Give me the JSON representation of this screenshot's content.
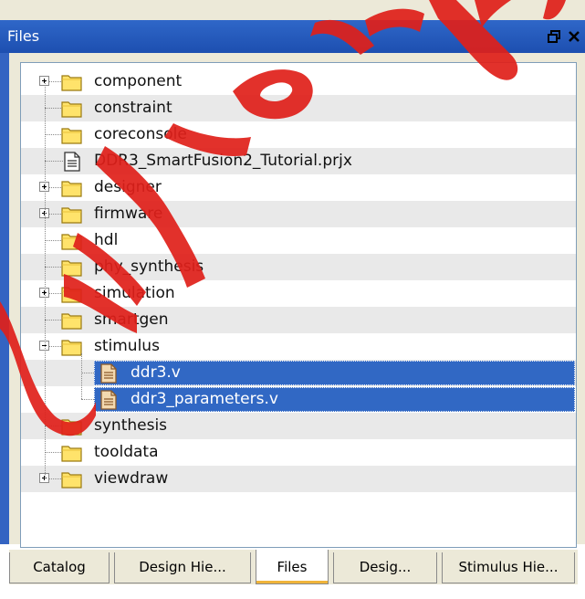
{
  "panel": {
    "title": "Files",
    "restore_icon": "restore-icon",
    "close_icon": "close-icon"
  },
  "tree": {
    "items": [
      {
        "label": "component",
        "type": "folder",
        "expander": "plus"
      },
      {
        "label": "constraint",
        "type": "folder",
        "expander": "none"
      },
      {
        "label": "coreconsole",
        "type": "folder",
        "expander": "none"
      },
      {
        "label": "DDR3_SmartFusion2_Tutorial.prjx",
        "type": "file",
        "expander": "none"
      },
      {
        "label": "designer",
        "type": "folder",
        "expander": "plus"
      },
      {
        "label": "firmware",
        "type": "folder",
        "expander": "plus"
      },
      {
        "label": "hdl",
        "type": "folder",
        "expander": "none"
      },
      {
        "label": "phy_synthesis",
        "type": "folder",
        "expander": "none"
      },
      {
        "label": "simulation",
        "type": "folder",
        "expander": "plus"
      },
      {
        "label": "smartgen",
        "type": "folder",
        "expander": "none"
      },
      {
        "label": "stimulus",
        "type": "folder",
        "expander": "minus"
      },
      {
        "label": "ddr3.v",
        "type": "file",
        "expander": "none",
        "selected": true
      },
      {
        "label": "ddr3_parameters.v",
        "type": "file",
        "expander": "none",
        "selected": true
      },
      {
        "label": "synthesis",
        "type": "folder",
        "expander": "none"
      },
      {
        "label": "tooldata",
        "type": "folder",
        "expander": "none"
      },
      {
        "label": "viewdraw",
        "type": "folder",
        "expander": "plus"
      }
    ]
  },
  "tabs": [
    {
      "label": "Catalog"
    },
    {
      "label": "Design Hie..."
    },
    {
      "label": "Files",
      "active": true
    },
    {
      "label": "Desig..."
    },
    {
      "label": "Stimulus Hie..."
    }
  ],
  "colors": {
    "titlebar": "#2f67c8",
    "selection": "#3168c4",
    "folder": "#ffe36b",
    "active_tab_accent": "#f0b43a"
  }
}
